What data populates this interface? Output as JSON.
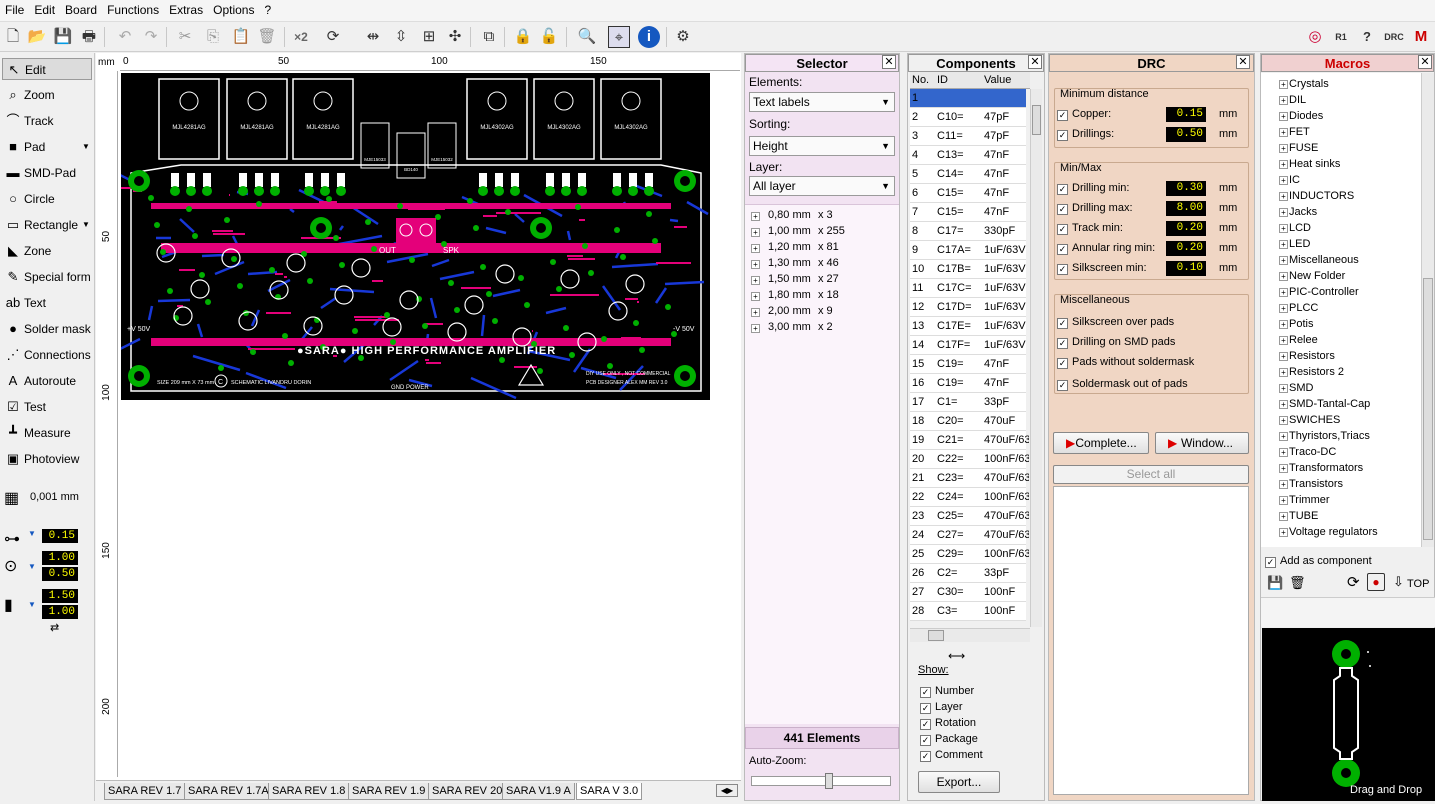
{
  "menu": [
    "File",
    "Edit",
    "Board",
    "Functions",
    "Extras",
    "Options",
    "?"
  ],
  "tools": [
    {
      "label": "Edit",
      "icon": "cursor-icon"
    },
    {
      "label": "Zoom",
      "icon": "magnifier-icon"
    },
    {
      "label": "Track",
      "icon": "track-icon"
    },
    {
      "label": "Pad",
      "icon": "pad-icon"
    },
    {
      "label": "SMD-Pad",
      "icon": "smd-pad-icon"
    },
    {
      "label": "Circle",
      "icon": "circle-icon"
    },
    {
      "label": "Rectangle",
      "icon": "rectangle-icon"
    },
    {
      "label": "Zone",
      "icon": "zone-icon"
    },
    {
      "label": "Special form",
      "icon": "special-form-icon"
    },
    {
      "label": "Text",
      "icon": "text-icon"
    },
    {
      "label": "Solder mask",
      "icon": "solder-mask-icon"
    },
    {
      "label": "Connections",
      "icon": "connections-icon"
    },
    {
      "label": "Autoroute",
      "icon": "autoroute-icon"
    },
    {
      "label": "Test",
      "icon": "test-icon"
    },
    {
      "label": "Measure",
      "icon": "measure-icon"
    },
    {
      "label": "Photoview",
      "icon": "photoview-icon"
    }
  ],
  "grid": {
    "value": "0,001 mm"
  },
  "track_width": "0.15",
  "pad_outer": "1.00",
  "pad_inner": "0.50",
  "smd_w": "1.50",
  "smd_h": "1.00",
  "ruler": {
    "unit": "mm",
    "top": [
      "0",
      "50",
      "100",
      "150"
    ],
    "left": [
      "50",
      "100",
      "150",
      "200"
    ]
  },
  "pcb": {
    "title": "●SARA● HIGH PERFORMANCE AMPLIFIER",
    "size": "SIZE 209 mm X 73 mm",
    "schematic": "SCHEMATIC LIVANDRU DORIN",
    "ground": "GND POWER",
    "credits1": "DIY USE ONLY , NOT COMMERCIAL",
    "credits2": "PCB DESIGNER ALEX MM     REV 3.0",
    "vpos": "+V 50V",
    "vneg": "-V 50V",
    "out": "OUT",
    "spk": "SPK",
    "transistors": [
      "MJL4281AG",
      "MJL4281AG",
      "MJL4281AG",
      "MJL4302AG",
      "MJL4302AG",
      "MJL4302AG"
    ],
    "drivers": [
      "MJE15033",
      "BD140",
      "MJE15032"
    ]
  },
  "tabs": [
    "SARA REV 1.7",
    "SARA REV 1.7A",
    "SARA REV 1.8",
    "SARA REV 1.9",
    "SARA REV 20",
    "SARA V1.9 A",
    "SARA V 3.0"
  ],
  "selector": {
    "title": "Selector",
    "elements_label": "Elements:",
    "elements_value": "Text labels",
    "sorting_label": "Sorting:",
    "sorting_value": "Height",
    "layer_label": "Layer:",
    "layer_value": "All layer",
    "items": [
      {
        "size": "0,80 mm",
        "count": "x 3"
      },
      {
        "size": "1,00 mm",
        "count": "x 255"
      },
      {
        "size": "1,20 mm",
        "count": "x 81"
      },
      {
        "size": "1,30 mm",
        "count": "x 46"
      },
      {
        "size": "1,50 mm",
        "count": "x 27"
      },
      {
        "size": "1,80 mm",
        "count": "x 18"
      },
      {
        "size": "2,00 mm",
        "count": "x 9"
      },
      {
        "size": "3,00 mm",
        "count": "x 2"
      }
    ],
    "total": "441 Elements",
    "autozoom": "Auto-Zoom:",
    "autozoom_level": 0.55
  },
  "components": {
    "title": "Components",
    "headers": [
      "No.",
      "ID",
      "Value"
    ],
    "rows": [
      [
        "1",
        "",
        ""
      ],
      [
        "2",
        "C10=",
        "47pF"
      ],
      [
        "3",
        "C11=",
        "47pF"
      ],
      [
        "4",
        "C13=",
        "47nF"
      ],
      [
        "5",
        "C14=",
        "47nF"
      ],
      [
        "6",
        "C15=",
        "47nF"
      ],
      [
        "7",
        "C15=",
        "47nF"
      ],
      [
        "8",
        "C17=",
        "330pF"
      ],
      [
        "9",
        "C17A=",
        "1uF/63V"
      ],
      [
        "10",
        "C17B=",
        "1uF/63V"
      ],
      [
        "11",
        "C17C=",
        "1uF/63V"
      ],
      [
        "12",
        "C17D=",
        "1uF/63V"
      ],
      [
        "13",
        "C17E=",
        "1uF/63V"
      ],
      [
        "14",
        "C17F=",
        "1uF/63V"
      ],
      [
        "15",
        "C19=",
        "47nF"
      ],
      [
        "16",
        "C19=",
        "47nF"
      ],
      [
        "17",
        "C1=",
        "33pF"
      ],
      [
        "18",
        "C20=",
        "470uF"
      ],
      [
        "19",
        "C21=",
        "470uF/63"
      ],
      [
        "20",
        "C22=",
        "100nF/63"
      ],
      [
        "21",
        "C23=",
        "470uF/63"
      ],
      [
        "22",
        "C24=",
        "100nF/63"
      ],
      [
        "23",
        "C25=",
        "470uF/63"
      ],
      [
        "24",
        "C27=",
        "470uF/63"
      ],
      [
        "25",
        "C29=",
        "100nF/63"
      ],
      [
        "26",
        "C2=",
        "33pF"
      ],
      [
        "27",
        "C30=",
        "100nF"
      ],
      [
        "28",
        "C3=",
        "100nF"
      ]
    ],
    "show_label": "Show:",
    "show": [
      "Number",
      "Layer",
      "Rotation",
      "Package",
      "Comment"
    ],
    "export": "Export..."
  },
  "drc": {
    "title": "DRC",
    "min_distance": "Minimum distance",
    "copper": "Copper:",
    "copper_v": "0.15",
    "drillings": "Drillings:",
    "drillings_v": "0.50",
    "minmax": "Min/Max",
    "dmin": "Drilling min:",
    "dmin_v": "0.30",
    "dmax": "Drilling max:",
    "dmax_v": "8.00",
    "tmin": "Track min:",
    "tmin_v": "0.20",
    "ring": "Annular ring min:",
    "ring_v": "0.20",
    "silk": "Silkscreen min:",
    "silk_v": "0.10",
    "misc": "Miscellaneous",
    "m1": "Silkscreen over pads",
    "m2": "Drilling on SMD pads",
    "m3": "Pads without soldermask",
    "m4": "Soldermask out of pads",
    "unit": "mm",
    "complete": "Complete...",
    "window": "Window...",
    "select_all": "Select all"
  },
  "macros": {
    "title": "Macros",
    "items": [
      "Crystals",
      "DIL",
      "Diodes",
      "FET",
      "FUSE",
      "Heat sinks",
      "IC",
      "INDUCTORS",
      "Jacks",
      "LCD",
      "LED",
      "Miscellaneous",
      "New Folder",
      "PIC-Controller",
      "PLCC",
      "Potis",
      "Relee",
      "Resistors",
      "Resistors 2",
      "SMD",
      "SMD-Tantal-Cap",
      "SWICHES",
      "Thyristors,Triacs",
      "Traco-DC",
      "Transformators",
      "Transistors",
      "Trimmer",
      "TUBE",
      "Voltage regulators"
    ],
    "add_component": "Add as component",
    "top": "TOP",
    "drag": "Drag and Drop"
  },
  "colors": {
    "pcb_bg": "#000000",
    "silk": "#ffffff",
    "pad": "#00b000",
    "top_copper": "#e4007a",
    "bottom_copper": "#1838d8",
    "selected_row": "#3366cc"
  }
}
